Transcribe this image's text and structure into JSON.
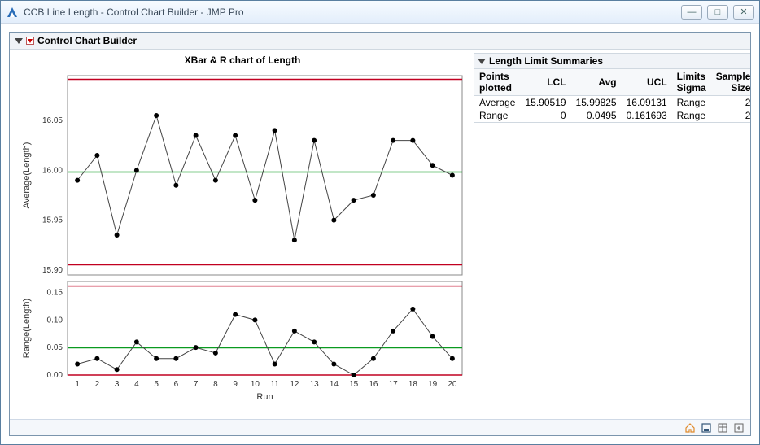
{
  "window": {
    "title": "CCB Line Length - Control Chart Builder - JMP Pro"
  },
  "panel": {
    "title": "Control Chart Builder"
  },
  "chart": {
    "title": "XBar & R chart of Length",
    "xlabel": "Run",
    "xbar": {
      "ylabel": "Average(Length)",
      "yticks": [
        "15.90",
        "15.95",
        "16.00",
        "16.05"
      ],
      "ylim": [
        15.895,
        16.095
      ],
      "avg": 15.99825,
      "ucl": 16.09131,
      "lcl": 15.90519
    },
    "range": {
      "ylabel": "Range(Length)",
      "yticks": [
        "0.00",
        "0.05",
        "0.10",
        "0.15"
      ],
      "ylim": [
        0.0,
        0.17
      ],
      "avg": 0.0495,
      "ucl": 0.161693,
      "lcl": 0
    },
    "xticks": [
      "1",
      "2",
      "3",
      "4",
      "5",
      "6",
      "7",
      "8",
      "9",
      "10",
      "11",
      "12",
      "13",
      "14",
      "15",
      "16",
      "17",
      "18",
      "19",
      "20"
    ]
  },
  "summary": {
    "title": "Length Limit Summaries",
    "headers": {
      "points": "Points plotted",
      "lcl": "LCL",
      "avg": "Avg",
      "ucl": "UCL",
      "sigma": "Limits Sigma",
      "n": "Sample Size"
    },
    "rows": [
      {
        "points": "Average",
        "lcl": "15.90519",
        "avg": "15.99825",
        "ucl": "16.09131",
        "sigma": "Range",
        "n": "2"
      },
      {
        "points": "Range",
        "lcl": "0",
        "avg": "0.0495",
        "ucl": "0.161693",
        "sigma": "Range",
        "n": "2"
      }
    ]
  },
  "chart_data": [
    {
      "type": "line",
      "title": "XBar chart of Length",
      "xlabel": "Run",
      "ylabel": "Average(Length)",
      "x": [
        1,
        2,
        3,
        4,
        5,
        6,
        7,
        8,
        9,
        10,
        11,
        12,
        13,
        14,
        15,
        16,
        17,
        18,
        19,
        20
      ],
      "values": [
        15.99,
        16.015,
        15.935,
        16.0,
        16.055,
        15.985,
        16.035,
        15.99,
        16.035,
        15.97,
        16.04,
        15.93,
        16.03,
        15.95,
        15.97,
        15.975,
        16.03,
        16.03,
        16.005,
        15.995
      ],
      "limits": {
        "lcl": 15.90519,
        "avg": 15.99825,
        "ucl": 16.09131
      },
      "ylim": [
        15.895,
        16.095
      ]
    },
    {
      "type": "line",
      "title": "R chart of Length",
      "xlabel": "Run",
      "ylabel": "Range(Length)",
      "x": [
        1,
        2,
        3,
        4,
        5,
        6,
        7,
        8,
        9,
        10,
        11,
        12,
        13,
        14,
        15,
        16,
        17,
        18,
        19,
        20
      ],
      "values": [
        0.02,
        0.03,
        0.01,
        0.06,
        0.03,
        0.03,
        0.05,
        0.04,
        0.11,
        0.1,
        0.02,
        0.08,
        0.06,
        0.02,
        0.0,
        0.03,
        0.08,
        0.12,
        0.07,
        0.03
      ],
      "limits": {
        "lcl": 0,
        "avg": 0.0495,
        "ucl": 0.161693
      },
      "ylim": [
        0.0,
        0.17
      ]
    }
  ]
}
